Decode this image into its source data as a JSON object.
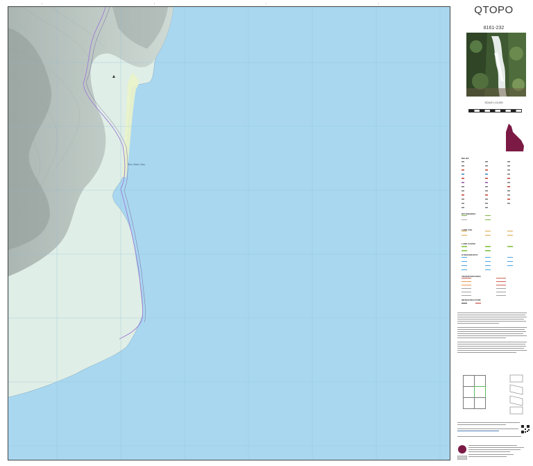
{
  "header": {
    "title": "QTOPO",
    "sheet_number": "8161-232",
    "scale_label": "SCALE 1:10,000"
  },
  "map": {
    "place_labels": [
      "Blue Water Way"
    ],
    "colors": {
      "sea": "#a9d7f0",
      "land": "#dfeee6",
      "beach": "#eaf3c9",
      "hills": "#b7bfbc",
      "roads": "#9e7bd4"
    }
  },
  "sidebar": {
    "legend_sections": [
      "RELIEF",
      "BOUNDARIES",
      "LAND USE",
      "LAND COVER",
      "HYDROGRAPHY",
      "TRANSPORTATION",
      "INFRASTRUCTURE"
    ]
  },
  "icons": [
    "waterfall-photo",
    "queensland-locator-map",
    "qr-code-icon",
    "qld-government-crest"
  ]
}
